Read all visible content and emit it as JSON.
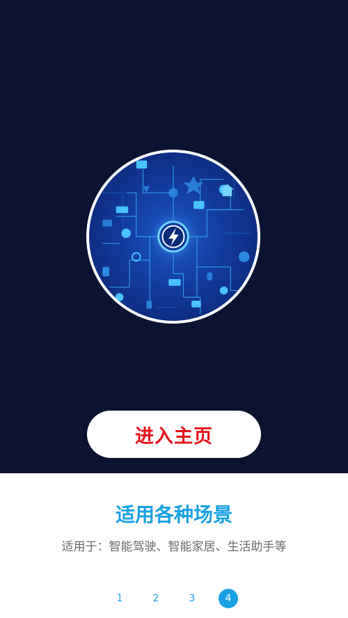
{
  "hero": {
    "image_icon": "smart-network-icon",
    "colors": {
      "background": "#0b1330",
      "circle_border": "#ffffff",
      "network_lines": "#3ab8ff"
    }
  },
  "enter_button": {
    "label": "进入主页",
    "color": "#e8121b"
  },
  "content": {
    "title": "适用各种场景",
    "subtitle": "适用于：智能驾驶、智能家居、生活助手等",
    "title_color": "#1aa1e3"
  },
  "pager": {
    "pages": [
      "1",
      "2",
      "3",
      "4"
    ],
    "active_page": "4",
    "accent": "#1aa1e3"
  }
}
